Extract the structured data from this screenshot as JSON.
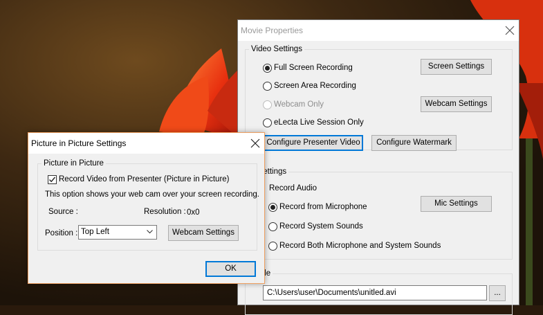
{
  "movie_properties": {
    "title": "Movie Properties",
    "video_settings": {
      "legend": "Video Settings",
      "options": [
        {
          "label": "Full Screen Recording",
          "selected": true,
          "disabled": false
        },
        {
          "label": "Screen Area Recording",
          "selected": false,
          "disabled": false
        },
        {
          "label": "Webcam Only",
          "selected": false,
          "disabled": true
        },
        {
          "label": "eLecta Live Session Only",
          "selected": false,
          "disabled": false
        }
      ],
      "screen_settings_label": "Screen Settings",
      "webcam_settings_label": "Webcam Settings",
      "configure_presenter_label": "Configure Presenter Video",
      "configure_watermark_label": "Configure Watermark"
    },
    "audio_settings": {
      "legend_visible": "o Settings",
      "record_audio_label": "Record Audio",
      "options": [
        {
          "label": "Record from Microphone",
          "selected": true
        },
        {
          "label": "Record System Sounds",
          "selected": false
        },
        {
          "label": "Record Both Microphone and System Sounds",
          "selected": false
        }
      ],
      "mic_settings_label": "Mic Settings"
    },
    "file": {
      "legend_visible": "e File",
      "path": "C:\\Users\\user\\Documents\\unitled.avi",
      "browse_label": "..."
    }
  },
  "pip_dialog": {
    "title": "Picture in Picture Settings",
    "group_legend": "Picture in Picture",
    "checkbox_label": "Record Video from Presenter (Picture in Picture)",
    "checkbox_checked": true,
    "description": "This option shows your web cam over your screen recording.",
    "source_label": "Source :",
    "resolution_label": "Resolution :",
    "resolution_value": "0x0",
    "position_label": "Position :",
    "position_value": "Top Left",
    "webcam_settings_label": "Webcam Settings",
    "ok_label": "OK"
  },
  "colors": {
    "accent": "#0078d7",
    "dialog_border": "#f0a060"
  }
}
